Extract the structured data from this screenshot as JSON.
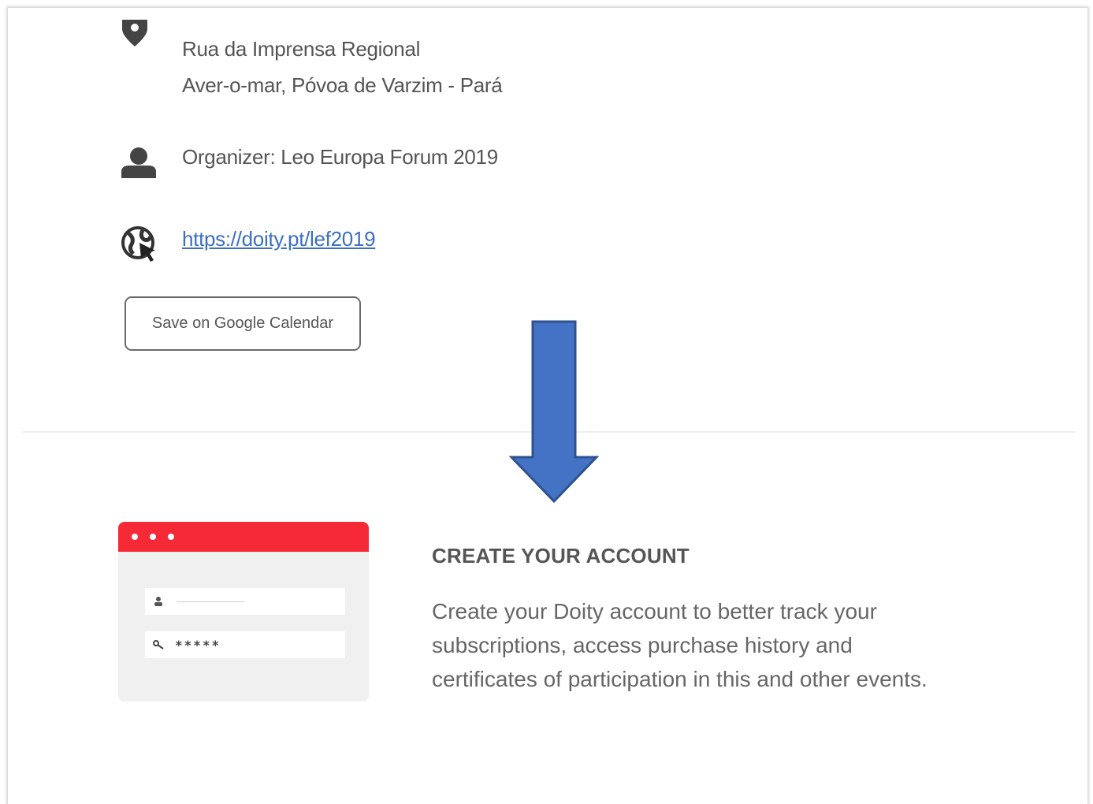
{
  "event_details": {
    "address_line_1": "Rua da Imprensa Regional",
    "address_line_2": "Aver-o-mar, Póvoa de Varzim - Pará",
    "organizer": "Organizer: Leo Europa Forum 2019",
    "url": "https://doity.pt/lef2019",
    "calendar_button_label": "Save on Google Calendar"
  },
  "account_promo": {
    "title": "CREATE YOUR ACCOUNT",
    "description_lines": [
      "Create your Doity account to better track your",
      "subscriptions, access purchase history and",
      "certificates of participation in this and other events."
    ],
    "illustration": {
      "password_mask": "*****"
    }
  },
  "colors": {
    "accent_red": "#f52a36",
    "arrow_blue": "#4472c4",
    "link_blue": "#3b6fc0",
    "text_gray": "#555555"
  },
  "icons": {
    "location": "map-pin-icon",
    "organizer": "user-icon",
    "website": "globe-cursor-icon",
    "annotation": "down-arrow-icon"
  }
}
